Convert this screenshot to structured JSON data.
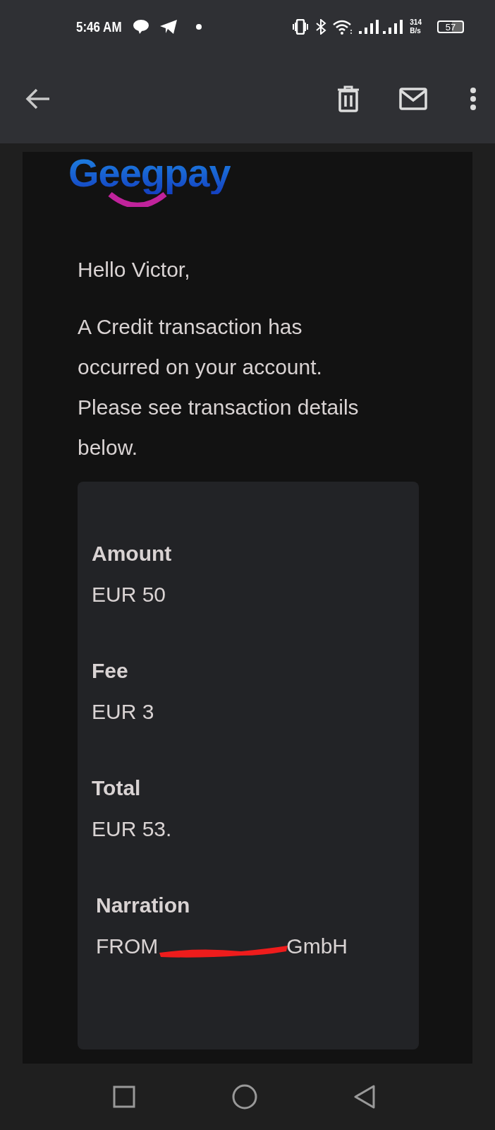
{
  "status_bar": {
    "time": "5:46 AM",
    "speed_value": "314",
    "speed_unit": "B/s",
    "battery": "57"
  },
  "email": {
    "logo": "Geegpay",
    "greeting": "Hello Victor,",
    "message": "A Credit transaction has occurred on your account. Please see transaction details below.",
    "details": [
      {
        "label": "Amount",
        "value": "EUR 50"
      },
      {
        "label": "Fee",
        "value": "EUR 3"
      },
      {
        "label": "Total",
        "value": "EUR 53."
      }
    ],
    "narration": {
      "label": "Narration",
      "value_start": "FROM",
      "value_end": "GmbH"
    }
  }
}
